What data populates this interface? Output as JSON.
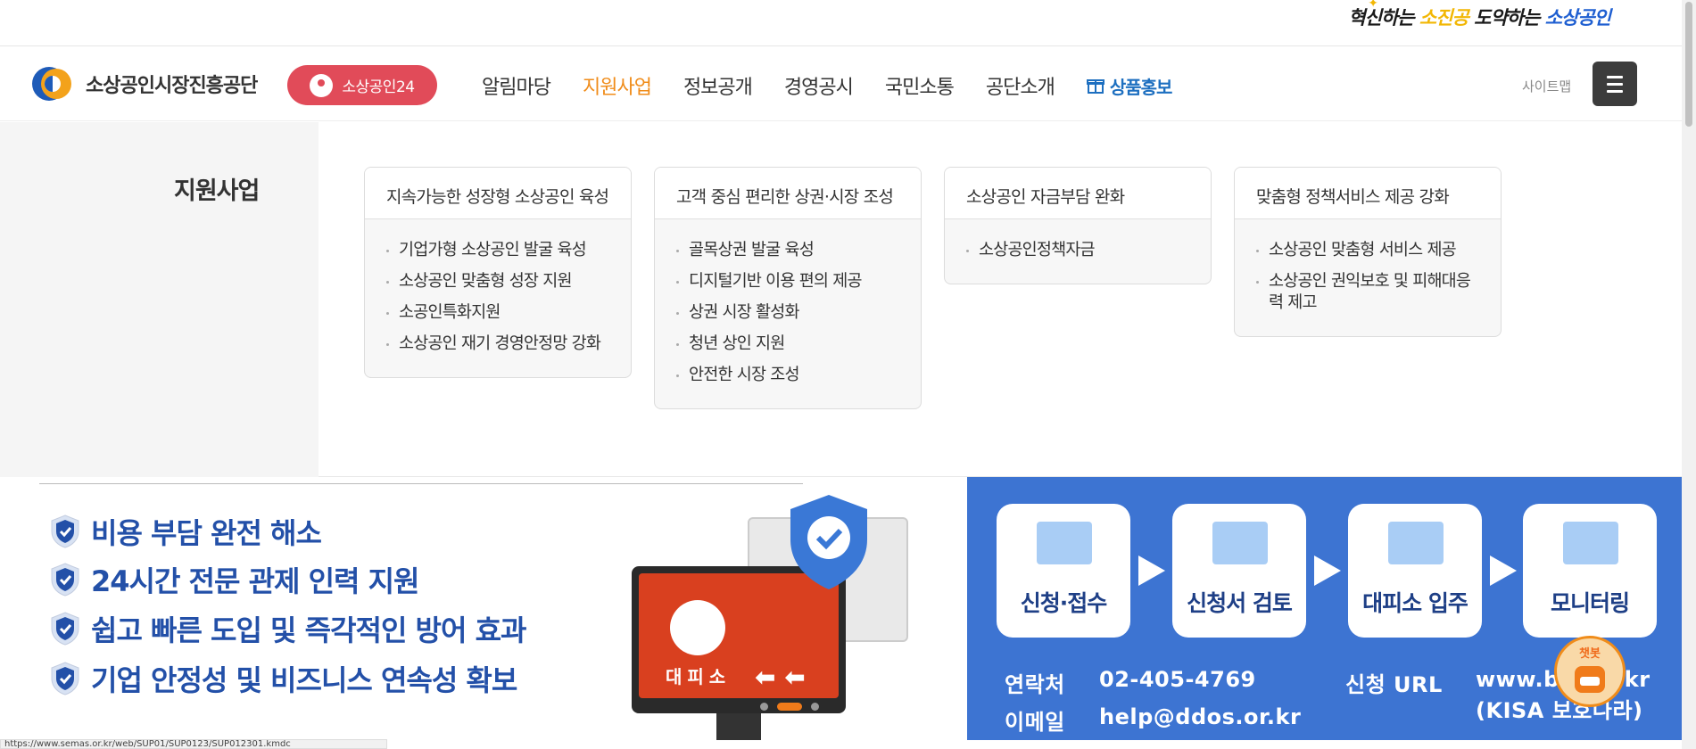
{
  "slogan": {
    "part1": "혁신하는 ",
    "part2": "소진공",
    "part3": " 도약하는 ",
    "part4": "소상공인"
  },
  "header": {
    "org_name": "소상공인시장진흥공단",
    "b24_label": "소상공인24",
    "nav": [
      "알림마당",
      "지원사업",
      "정보공개",
      "경영공시",
      "국민소통",
      "공단소개"
    ],
    "active_nav": "지원사업",
    "gift_label": "상품홍보",
    "sitemap_label": "사이트맵"
  },
  "mega": {
    "title": "지원사업",
    "columns": [
      {
        "heading": "지속가능한 성장형 소상공인 육성",
        "items": [
          "기업가형 소상공인 발굴 육성",
          "소상공인 맞춤형 성장 지원",
          "소공인특화지원",
          "소상공인 재기 경영안정망 강화"
        ]
      },
      {
        "heading": "고객 중심 편리한 상권·시장 조성",
        "items": [
          "골목상권 발굴 육성",
          "디지털기반 이용 편의 제공",
          "상권 시장 활성화",
          "청년 상인 지원",
          "안전한 시장 조성"
        ]
      },
      {
        "heading": "소상공인 자금부담 완화",
        "items": [
          "소상공인정책자금"
        ]
      },
      {
        "heading": "맞춤형 정책서비스 제공 강화",
        "items": [
          "소상공인 맞춤형 서비스 제공",
          "소상공인 권익보호 및 피해대응력 제고"
        ]
      }
    ]
  },
  "banner": {
    "features": [
      "비용 부담 완전 해소",
      "24시간 전문 관제 인력 지원",
      "쉽고 빠른 도입 및 즉각적인 방어 효과",
      "기업 안정성 및 비즈니스 연속성 확보"
    ],
    "monitor_label": "대피소",
    "steps": [
      "신청·접수",
      "신청서 검토",
      "대피소 입주",
      "모니터링"
    ],
    "contact_label": "연락처",
    "contact_value": "02-405-4769",
    "email_label": "이메일",
    "email_value": "help@ddos.or.kr",
    "url_label": "신청 URL",
    "url_value": "www.bo___r.kr",
    "url_sub": "(KISA 보호나라)",
    "chatbot_label": "챗봇"
  },
  "status_url": "https://www.semas.or.kr/web/SUP01/SUP0123/SUP012301.kmdc",
  "colors": {
    "accent": "#f08c1a",
    "b24": "#e14b59",
    "banner_blue": "#3d74d2",
    "feature_text": "#2350a8"
  }
}
